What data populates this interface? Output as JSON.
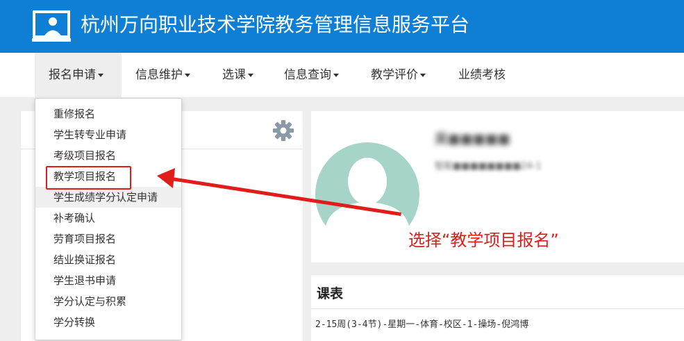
{
  "header": {
    "title": "杭州万向职业技术学院教务管理信息服务平台",
    "logo_icon": "presentation-screen-icon",
    "background": "#0f7fd6"
  },
  "nav": {
    "items": [
      {
        "label": "报名申请",
        "dropdown": true,
        "active": true
      },
      {
        "label": "信息维护",
        "dropdown": true
      },
      {
        "label": "选课",
        "dropdown": true
      },
      {
        "label": "信息查询",
        "dropdown": true
      },
      {
        "label": "教学评价",
        "dropdown": true
      },
      {
        "label": "业绩考核",
        "dropdown": false
      }
    ]
  },
  "dropdown": {
    "items": [
      "重修报名",
      "学生转专业申请",
      "考级项目报名",
      "教学项目报名",
      "学生成绩学分认定申请",
      "补考确认",
      "劳育项目报名",
      "结业换证报名",
      "学生退书申请",
      "学分认定与积累",
      "学分转换"
    ],
    "highlighted_index": 3,
    "hover_index": 4
  },
  "settings": {
    "icon": "gear-icon"
  },
  "profile": {
    "name_blurred": "吴■■■■■",
    "sub_blurred": "智能■■■■■■■■24-1",
    "avatar_icon": "user-avatar-icon",
    "avatar_bg": "#a6d4c8"
  },
  "annotation": {
    "text": "选择“教学项目报名”",
    "color": "#e21b1b"
  },
  "schedule": {
    "title": "课表",
    "rows": [
      "2-15周(3-4节)-星期一-体育-校区-1-操场-倪鸿博"
    ]
  }
}
